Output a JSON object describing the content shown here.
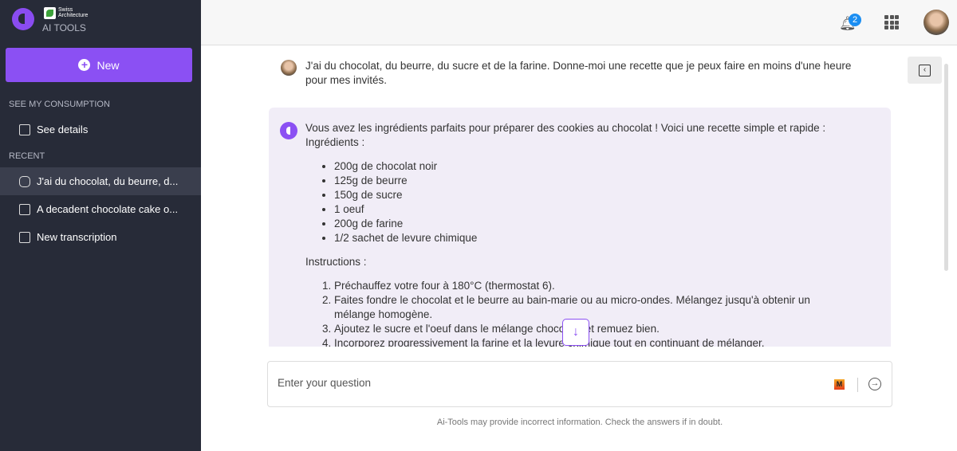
{
  "sidebar": {
    "brand": "Swiss Architecture",
    "app_name": "AI TOOLS",
    "new_label": "New",
    "consumption_header": "SEE MY CONSUMPTION",
    "see_details": "See details",
    "recent_header": "RECENT",
    "recent": [
      {
        "label": "J'ai du chocolat, du beurre, d...",
        "icon": "chat-sparkle-icon"
      },
      {
        "label": "A decadent chocolate cake o...",
        "icon": "image-sparkle-icon"
      },
      {
        "label": "New transcription",
        "icon": "audio-sparkle-icon"
      }
    ]
  },
  "topbar": {
    "notification_count": "2"
  },
  "conversation": {
    "user_message": "J'ai du chocolat, du beurre, du sucre et de la farine. Donne-moi une recette que je peux faire en moins d'une heure pour mes invités.",
    "bot_intro": "Vous avez les ingrédients parfaits pour préparer des cookies au chocolat ! Voici une recette simple et rapide :",
    "ingredients_title": "Ingrédients :",
    "ingredients": [
      "200g de chocolat noir",
      "125g de beurre",
      "150g de sucre",
      "1 oeuf",
      "200g de farine",
      "1/2 sachet de levure chimique"
    ],
    "instructions_title": "Instructions :",
    "instructions": [
      "Préchauffez votre four à 180°C (thermostat 6).",
      "Faites fondre le chocolat et le beurre au bain-marie ou au micro-ondes. Mélangez jusqu'à obtenir un mélange homogène.",
      "Ajoutez le sucre et l'oeuf dans le mélange chocolaté et remuez bien.",
      "Incorporez progressivement la farine et la levure chimique tout en continuant de mélanger."
    ]
  },
  "composer": {
    "placeholder": "Enter your question",
    "model_badge": "M",
    "disclaimer": "Ai-Tools may provide incorrect information. Check the answers if in doubt."
  },
  "colors": {
    "accent": "#8b50f3",
    "sidebar": "#272b38",
    "badge": "#1b8ef2"
  }
}
